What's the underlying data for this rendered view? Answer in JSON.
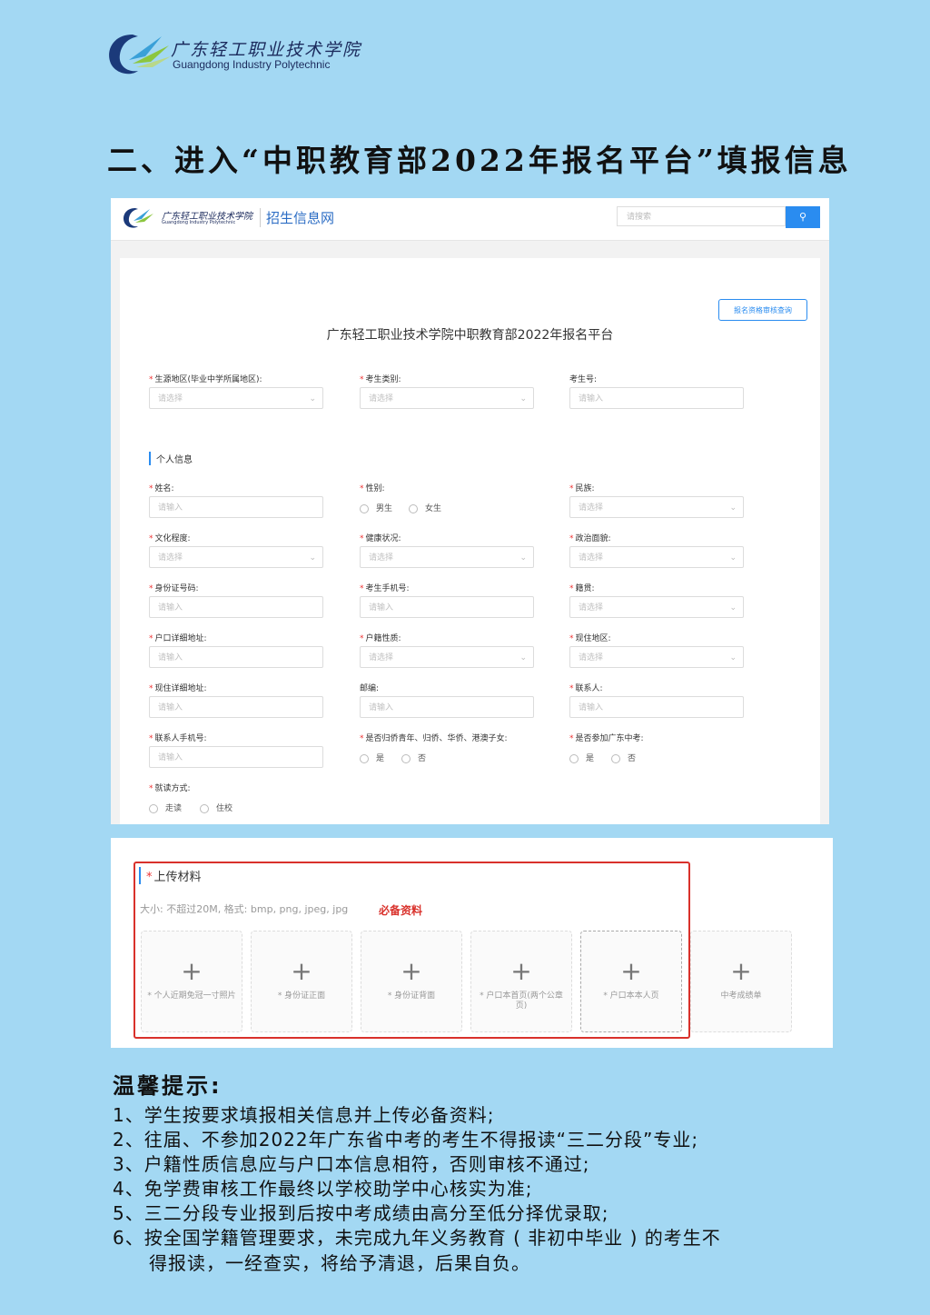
{
  "header": {
    "school_cn": "广东轻工职业技术学院",
    "school_en": "Guangdong Industry Polytechnic",
    "headline": "二、进入“中职教育部2022年报名平台”填报信息"
  },
  "site": {
    "title": "招生信息网",
    "search_placeholder": "请搜索",
    "query_button": "报名资格审核查询",
    "form_title": "广东轻工职业技术学院中职教育部2022年报名平台"
  },
  "top_fields": [
    {
      "label": "生源地区(毕业中学所属地区):",
      "required": true,
      "placeholder": "请选择",
      "select": true
    },
    {
      "label": "考生类别:",
      "required": true,
      "placeholder": "请选择",
      "select": true
    },
    {
      "label": "考生号:",
      "required": false,
      "placeholder": "请输入",
      "select": false
    }
  ],
  "section_personal": "个人信息",
  "fields": [
    {
      "label": "姓名:",
      "required": true,
      "placeholder": "请输入",
      "select": false
    },
    {
      "label": "民族:",
      "required": true,
      "placeholder": "请选择",
      "select": true
    },
    {
      "label": "文化程度:",
      "required": true,
      "placeholder": "请选择",
      "select": true
    },
    {
      "label": "健康状况:",
      "required": true,
      "placeholder": "请选择",
      "select": true
    },
    {
      "label": "政治面貌:",
      "required": true,
      "placeholder": "请选择",
      "select": true
    },
    {
      "label": "身份证号码:",
      "required": true,
      "placeholder": "请输入",
      "select": false
    },
    {
      "label": "考生手机号:",
      "required": true,
      "placeholder": "请输入",
      "select": false
    },
    {
      "label": "籍贯:",
      "required": true,
      "placeholder": "请选择",
      "select": true
    },
    {
      "label": "户口详细地址:",
      "required": true,
      "placeholder": "请输入",
      "select": false
    },
    {
      "label": "户籍性质:",
      "required": true,
      "placeholder": "请选择",
      "select": true
    },
    {
      "label": "现住地区:",
      "required": true,
      "placeholder": "请选择",
      "select": true
    },
    {
      "label": "现住详细地址:",
      "required": true,
      "placeholder": "请输入",
      "select": false
    },
    {
      "label": "邮编:",
      "required": false,
      "placeholder": "请输入",
      "select": false
    },
    {
      "label": "联系人:",
      "required": true,
      "placeholder": "请输入",
      "select": false
    },
    {
      "label": "联系人手机号:",
      "required": true,
      "placeholder": "请输入",
      "select": false
    }
  ],
  "radios": {
    "gender": {
      "label": "性别:",
      "options": [
        "男生",
        "女生"
      ]
    },
    "overseas": {
      "label": "是否归侨青年、归侨、华侨、港澳子女:",
      "options": [
        "是",
        "否"
      ]
    },
    "zhongkao": {
      "label": "是否参加广东中考:",
      "options": [
        "是",
        "否"
      ]
    },
    "study_mode": {
      "label": "就读方式:",
      "options": [
        "走读",
        "住校"
      ]
    }
  },
  "upload": {
    "title": "上传材料",
    "hint": "大小: 不超过20M, 格式: bmp, png, jpeg, jpg",
    "must_label": "必备资料",
    "tiles": [
      "* 个人近期免冠一寸照片",
      "* 身份证正面",
      "* 身份证背面",
      "* 户口本首页(两个公章页)",
      "* 户口本本人页",
      "中考成绩单"
    ]
  },
  "tips": {
    "title": "温馨提示:",
    "items": [
      "1、学生按要求填报相关信息并上传必备资料;",
      "2、往届、不参加2022年广东省中考的考生不得报读“三二分段”专业;",
      "3、户籍性质信息应与户口本信息相符，否则审核不通过;",
      "4、免学费审核工作最终以学校助学中心核实为准;",
      "5、三二分段专业报到后按中考成绩由高分至低分择优录取;",
      "6、按全国学籍管理要求，未完成九年义务教育 ( 非初中毕业 ) 的考生不",
      "得报读，一经查实，将给予清退，后果自负。"
    ]
  },
  "colors": {
    "background": "#a3d8f3",
    "accent": "#2a8cf0",
    "highlight": "#d9312b"
  }
}
